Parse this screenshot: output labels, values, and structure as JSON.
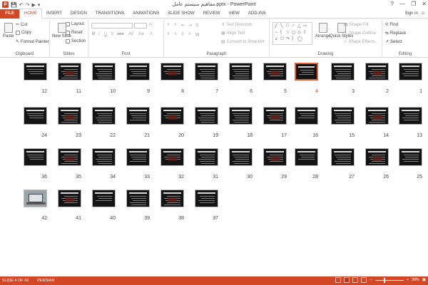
{
  "titlebar": {
    "app_icon": "P",
    "title": "مفاهيم سيستم عامل.pptx - PowerPoint",
    "help_icon": "?",
    "minimize_icon": "—",
    "restore_icon": "❐",
    "close_icon": "✕"
  },
  "tabs": [
    "FILE",
    "HOME",
    "INSERT",
    "DESIGN",
    "TRANSITIONS",
    "ANIMATIONS",
    "SLIDE SHOW",
    "REVIEW",
    "VIEW",
    "ADD-INS"
  ],
  "active_tab": "HOME",
  "signin": "Sign in",
  "ribbon": {
    "clipboard": {
      "label": "Clipboard",
      "paste": "Paste",
      "cut": "Cut",
      "copy": "Copy",
      "format_painter": "Format Painter"
    },
    "slides": {
      "label": "Slides",
      "new_slide": "New Slide",
      "layout": "Layout",
      "reset": "Reset",
      "section": "Section"
    },
    "font": {
      "label": "Font"
    },
    "paragraph": {
      "label": "Paragraph",
      "text_direction": "Text Direction",
      "align_text": "Align Text",
      "convert_smartart": "Convert to SmartArt"
    },
    "drawing": {
      "label": "Drawing",
      "arrange": "Arrange",
      "quick_styles": "Quick Styles",
      "shape_fill": "Shape Fill",
      "shape_outline": "Shape Outline",
      "shape_effects": "Shape Effects"
    },
    "editing": {
      "label": "Editing",
      "find": "Find",
      "replace": "Replace",
      "select": "Select"
    }
  },
  "slides": {
    "selected": 4,
    "rows": [
      [
        12,
        11,
        10,
        9,
        8,
        7,
        6,
        5,
        4,
        3,
        2,
        1
      ],
      [
        24,
        23,
        22,
        21,
        20,
        19,
        18,
        17,
        16,
        15,
        14,
        13
      ],
      [
        36,
        35,
        34,
        33,
        32,
        31,
        30,
        29,
        28,
        27,
        26,
        25
      ],
      [
        42,
        41,
        40,
        39,
        38,
        37
      ]
    ]
  },
  "status": {
    "slide_info": "SLIDE 4 OF 42",
    "language": "PERSIAN",
    "zoom": "38%",
    "zoom_minus": "−",
    "zoom_plus": "+"
  },
  "colors": {
    "accent": "#d24726",
    "selection": "#e0603a",
    "thumb_bg": "#141414"
  }
}
